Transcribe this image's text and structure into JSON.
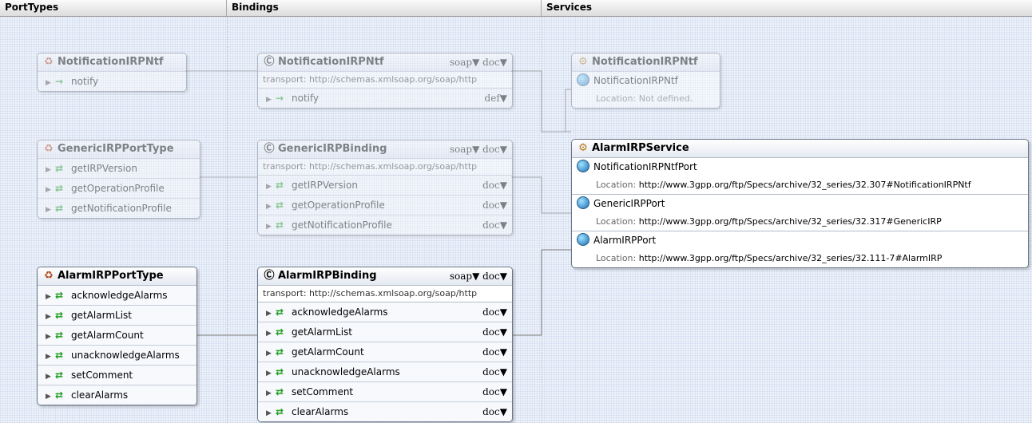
{
  "columns": [
    "PortTypes",
    "Bindings",
    "Services"
  ],
  "port_types": [
    {
      "name": "NotificationIRPNtf",
      "dim": true,
      "ops": [
        {
          "name": "notify",
          "kind": "one-way-arrow-icon"
        }
      ]
    },
    {
      "name": "GenericIRPPortType",
      "dim": true,
      "ops": [
        {
          "name": "getIRPVersion",
          "kind": "request-response-icon"
        },
        {
          "name": "getOperationProfile",
          "kind": "request-response-icon"
        },
        {
          "name": "getNotificationProfile",
          "kind": "request-response-icon"
        }
      ]
    },
    {
      "name": "AlarmIRPPortType",
      "dim": false,
      "ops": [
        {
          "name": "acknowledgeAlarms",
          "kind": "request-response-icon"
        },
        {
          "name": "getAlarmList",
          "kind": "request-response-icon"
        },
        {
          "name": "getAlarmCount",
          "kind": "request-response-icon"
        },
        {
          "name": "unacknowledgeAlarms",
          "kind": "request-response-icon"
        },
        {
          "name": "setComment",
          "kind": "request-response-icon"
        },
        {
          "name": "clearAlarms",
          "kind": "request-response-icon"
        }
      ]
    }
  ],
  "bindings": [
    {
      "name": "NotificationIRPNtf",
      "dim": true,
      "protocol": "soap",
      "style": "doc",
      "transport": "transport: http://schemas.xmlsoap.org/soap/http",
      "ops": [
        {
          "name": "notify",
          "tag": "def"
        }
      ]
    },
    {
      "name": "GenericIRPBinding",
      "dim": true,
      "protocol": "soap",
      "style": "doc",
      "transport": "transport: http://schemas.xmlsoap.org/soap/http",
      "ops": [
        {
          "name": "getIRPVersion",
          "tag": "doc"
        },
        {
          "name": "getOperationProfile",
          "tag": "doc"
        },
        {
          "name": "getNotificationProfile",
          "tag": "doc"
        }
      ]
    },
    {
      "name": "AlarmIRPBinding",
      "dim": false,
      "protocol": "soap",
      "style": "doc",
      "transport": "transport: http://schemas.xmlsoap.org/soap/http",
      "ops": [
        {
          "name": "acknowledgeAlarms",
          "tag": "doc"
        },
        {
          "name": "getAlarmList",
          "tag": "doc"
        },
        {
          "name": "getAlarmCount",
          "tag": "doc"
        },
        {
          "name": "unacknowledgeAlarms",
          "tag": "doc"
        },
        {
          "name": "setComment",
          "tag": "doc"
        },
        {
          "name": "clearAlarms",
          "tag": "doc"
        }
      ]
    }
  ],
  "services": [
    {
      "name": "NotificationIRPNtf",
      "dim": true,
      "ports": [
        {
          "name": "NotificationIRPNtf",
          "location_label": "Location:",
          "location": "Not defined."
        }
      ]
    },
    {
      "name": "AlarmIRPService",
      "dim": false,
      "ports": [
        {
          "name": "NotificationIRPNtfPort",
          "location_label": "Location:",
          "location": "http://www.3gpp.org/ftp/Specs/archive/32_series/32.307#NotificationIRPNtf"
        },
        {
          "name": "GenericIRPPort",
          "location_label": "Location:",
          "location": "http://www.3gpp.org/ftp/Specs/archive/32_series/32.317#GenericIRP"
        },
        {
          "name": "AlarmIRPPort",
          "location_label": "Location:",
          "location": "http://www.3gpp.org/ftp/Specs/archive/32_series/32.111-7#AlarmIRP"
        }
      ]
    }
  ]
}
